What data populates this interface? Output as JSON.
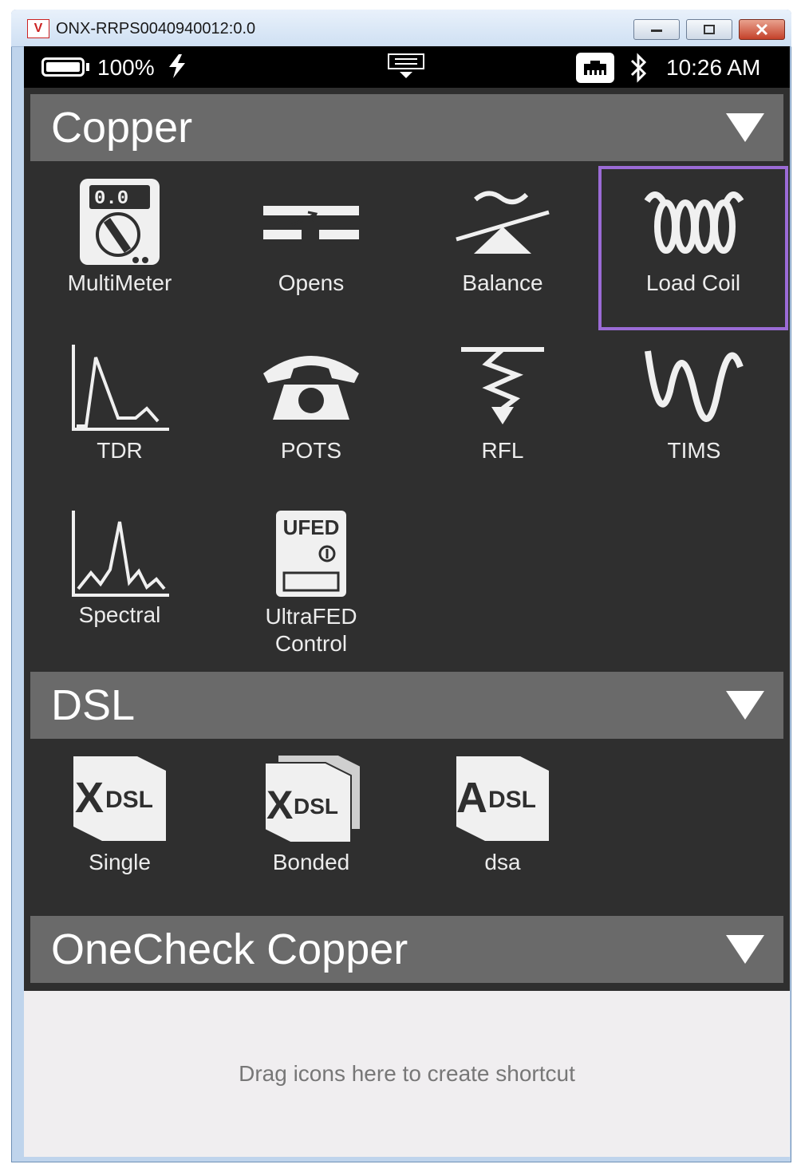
{
  "window": {
    "title": "ONX-RRPS0040940012:0.0",
    "logo_text": "V"
  },
  "statusbar": {
    "battery_percent": "100%",
    "time": "10:26 AM"
  },
  "sections": [
    {
      "title": "Copper",
      "tiles": [
        {
          "label": "MultiMeter",
          "icon": "multimeter-icon"
        },
        {
          "label": "Opens",
          "icon": "opens-icon"
        },
        {
          "label": "Balance",
          "icon": "balance-icon"
        },
        {
          "label": "Load Coil",
          "icon": "load-coil-icon",
          "selected": true
        },
        {
          "label": "TDR",
          "icon": "tdr-icon"
        },
        {
          "label": "POTS",
          "icon": "telephone-icon"
        },
        {
          "label": "RFL",
          "icon": "rfl-icon"
        },
        {
          "label": "TIMS",
          "icon": "sine-wave-icon"
        },
        {
          "label": "Spectral",
          "icon": "spectral-icon"
        },
        {
          "label": "UltraFED",
          "label2": "Control",
          "icon": "ultrafed-icon",
          "icon_text": "UFED"
        }
      ]
    },
    {
      "title": "DSL",
      "tiles": [
        {
          "label": "Single",
          "icon": "xdsl-single-icon",
          "icon_text_big": "X",
          "icon_text_small": "DSL"
        },
        {
          "label": "Bonded",
          "icon": "xdsl-bonded-icon",
          "icon_text_big": "X",
          "icon_text_small": "DSL"
        },
        {
          "label": "dsa",
          "icon": "adsl-icon",
          "icon_text_big": "A",
          "icon_text_small": "DSL"
        }
      ]
    },
    {
      "title": "OneCheck Copper",
      "tiles": []
    }
  ],
  "shortcut_hint": "Drag icons here to create shortcut",
  "colors": {
    "background": "#2f2f2f",
    "header": "#6a6a6a",
    "selection": "#9b6bd6",
    "statusbar": "#000000"
  }
}
